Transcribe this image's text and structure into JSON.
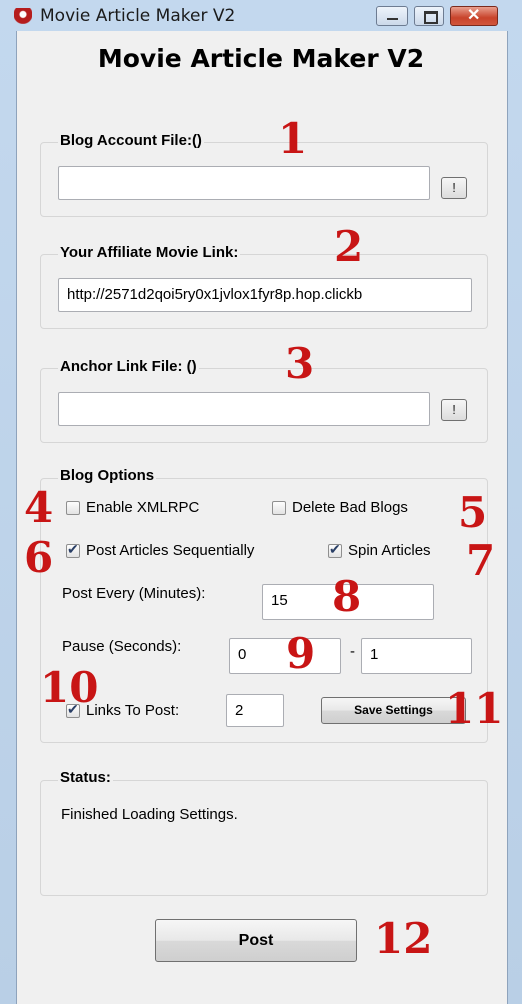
{
  "window": {
    "title": "Movie Article Maker V2",
    "controls": {
      "minimize_icon": "minimize-icon",
      "maximize_icon": "maximize-icon",
      "close_icon": "close-icon",
      "close_glyph": "✕"
    }
  },
  "app_title": "Movie Article Maker V2",
  "blog_account": {
    "label": "Blog Account File:()",
    "value": "",
    "browse_label": "!"
  },
  "affiliate": {
    "label": "Your Affiliate Movie Link:",
    "value": "http://2571d2qoi5ry0x1jvlox1fyr8p.hop.clickb"
  },
  "anchor": {
    "label": "Anchor Link File: ()",
    "value": "",
    "browse_label": "!"
  },
  "blog_options": {
    "label": "Blog Options",
    "enable_xmlrpc": {
      "label": "Enable XMLRPC",
      "checked": false
    },
    "delete_bad_blogs": {
      "label": "Delete Bad Blogs",
      "checked": false
    },
    "post_sequentially": {
      "label": "Post Articles Sequentially",
      "checked": true
    },
    "spin_articles": {
      "label": "Spin Articles",
      "checked": true
    },
    "post_every_label": "Post Every (Minutes):",
    "post_every_value": "15",
    "pause_label": "Pause (Seconds):",
    "pause_min": "0",
    "pause_separator": "-",
    "pause_max": "1",
    "links_to_post": {
      "label": "Links To Post:",
      "checked": true,
      "value": "2"
    },
    "save_label": "Save Settings"
  },
  "status": {
    "label": "Status:",
    "text": "Finished Loading Settings."
  },
  "post_label": "Post",
  "annotations": [
    "1",
    "2",
    "3",
    "4",
    "5",
    "6",
    "7",
    "8",
    "9",
    "10",
    "11",
    "12"
  ],
  "colors": {
    "annotation": "#c81515",
    "window_frame": "#bfd4ea",
    "client": "#f0f0f0"
  }
}
